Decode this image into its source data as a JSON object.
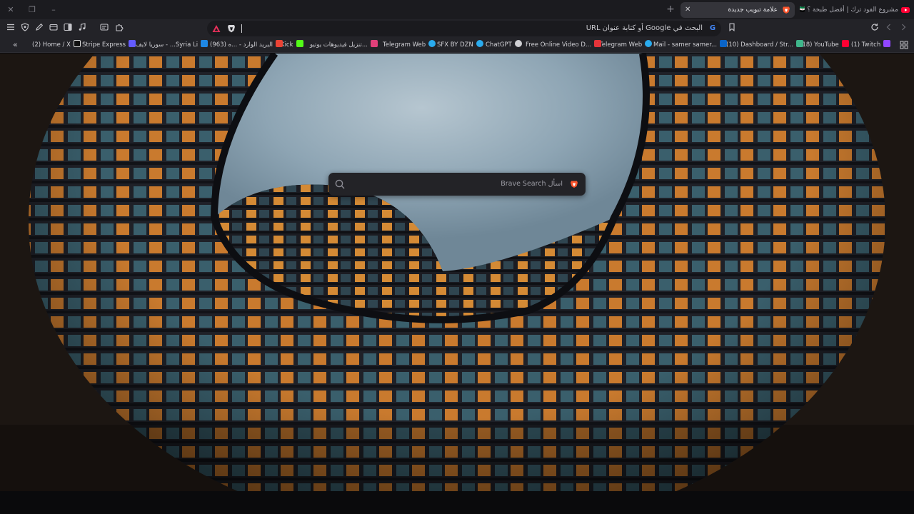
{
  "window": {
    "close_glyph": "✕",
    "restore_glyph": "❐",
    "minimize_glyph": "–"
  },
  "tabs": [
    {
      "title": "علامة تبويب جديدة",
      "close_glyph": "✕",
      "active": true
    },
    {
      "title": "مشروع الفود ترك | أفضل طبخة ؟ 🇸🇾 #",
      "active": false
    }
  ],
  "new_tab_glyph": "+",
  "toolbar": {
    "address_placeholder": "البحث في Google أو كتابة عنوان URL",
    "search_engine_glyph": "G"
  },
  "bookmarks": [
    {
      "label": "(1) Twitch",
      "icon": "twitch-icon",
      "color": "#9146ff"
    },
    {
      "label": "(18) YouTube",
      "icon": "youtube-icon",
      "color": "#ff0033"
    },
    {
      "label": "(10) Dashboard / Str...",
      "icon": "dashboard-icon",
      "color": "#3fb68b"
    },
    {
      "label": "Mail - samer samer...",
      "icon": "outlook-icon",
      "color": "#0a64c8"
    },
    {
      "label": "Telegram Web",
      "icon": "telegram-icon",
      "color": "#2aabee"
    },
    {
      "label": "Free Online Video D...",
      "icon": "4k-icon",
      "color": "#e5343a"
    },
    {
      "label": "ChatGPT",
      "icon": "chatgpt-icon",
      "color": "#d0d0d4"
    },
    {
      "label": "SFX BY DZN",
      "icon": "sfx-icon",
      "color": "#2aabee"
    },
    {
      "label": "Telegram Web",
      "icon": "telegram-icon",
      "color": "#2aabee"
    },
    {
      "label": "تنزيل فيديوهات يوتيو...",
      "icon": "downloader-icon",
      "color": "#e0407a"
    },
    {
      "label": "Kick",
      "icon": "kick-icon",
      "color": "#53fc18"
    },
    {
      "label": "البريد الوارد - ...ه (963)",
      "icon": "gmail-icon",
      "color": "#ea4335"
    },
    {
      "label": "سوريا لايف - ...Syria Li",
      "icon": "syria-live-icon",
      "color": "#1e88e5"
    },
    {
      "label": "Stripe Express",
      "icon": "stripe-icon",
      "color": "#635bff"
    },
    {
      "label": "(2) Home / X",
      "icon": "x-icon",
      "color": "#ffffff"
    }
  ],
  "bookmarks_overflow_glyph": "«",
  "search_box": {
    "placeholder": "اسأل Brave Search"
  },
  "colors": {
    "tabstrip": "#1b1b1f",
    "toolbar": "#232328",
    "brave_orange": "#fb542b",
    "sky": "#9fb4c2"
  }
}
